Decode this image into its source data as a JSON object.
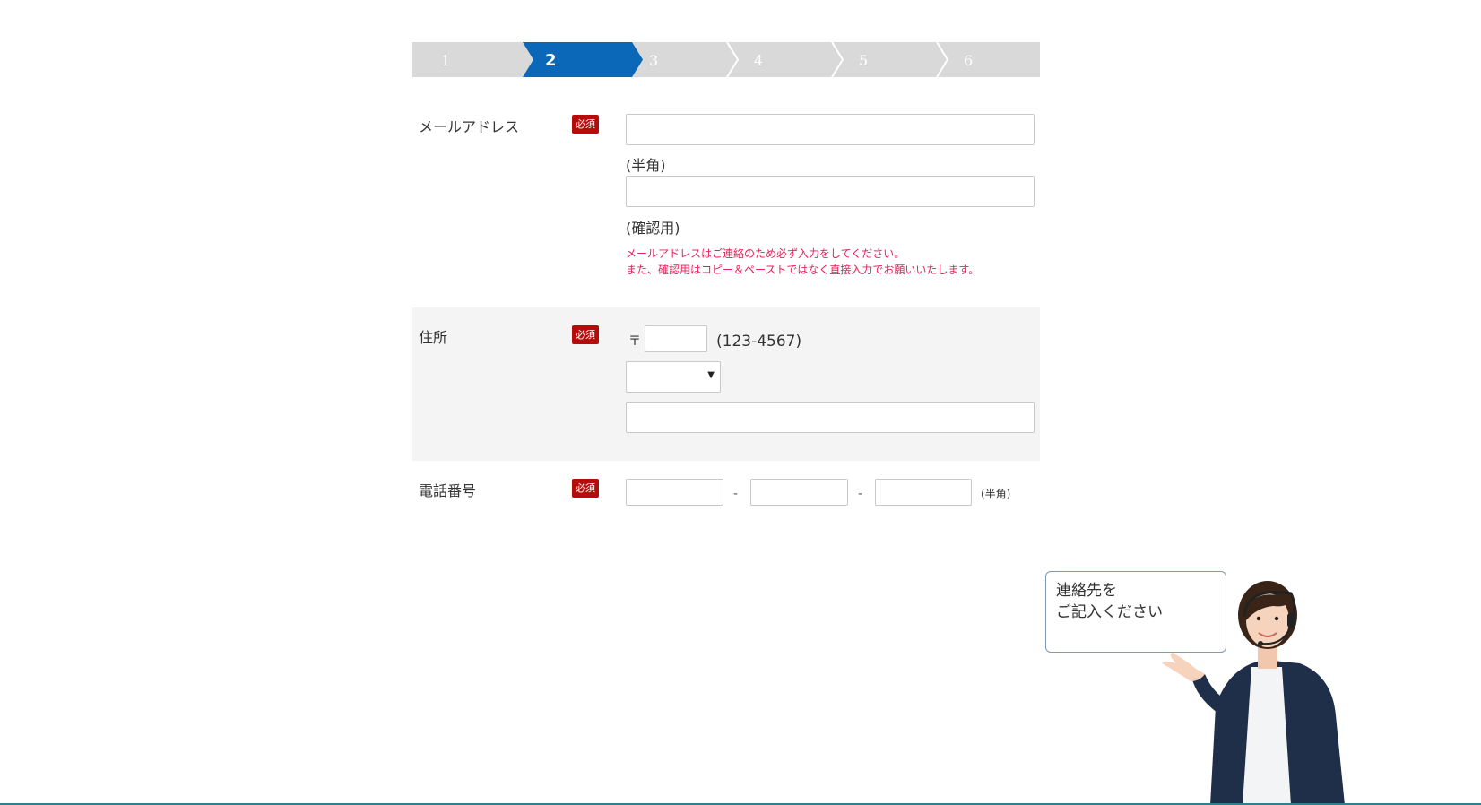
{
  "steps": {
    "items": [
      "1",
      "2",
      "3",
      "4",
      "5",
      "6"
    ],
    "active_index": 1,
    "colors": {
      "active": "#0b67b8",
      "inactive": "#d9d9d9"
    }
  },
  "email": {
    "label": "メールアドレス",
    "required_badge": "必須",
    "value": "",
    "note": "(半角)",
    "confirm_value": "",
    "confirm_note": "(確認用)",
    "error_line1": "メールアドレスはご連絡のため必ず入力をしてください。",
    "error_line2": "また、確認用はコピー＆ペーストではなく直接入力でお願いいたします。"
  },
  "address": {
    "label": "住所",
    "required_badge": "必須",
    "postal_mark": "〒",
    "postal_value": "",
    "postal_hint": "(123-4567)",
    "prefecture_selected": "",
    "prefecture_arrow": "▼",
    "street_value": ""
  },
  "phone": {
    "label": "電話番号",
    "required_badge": "必須",
    "part1": "",
    "part2": "",
    "part3": "",
    "separator": "-",
    "note": "(半角)"
  },
  "bubble": {
    "line1": "連絡先を",
    "line2": "ご記入ください"
  },
  "colors": {
    "required_badge": "#b60b0b",
    "error_text": "#e6215a",
    "section_bg": "#f4f4f4"
  }
}
